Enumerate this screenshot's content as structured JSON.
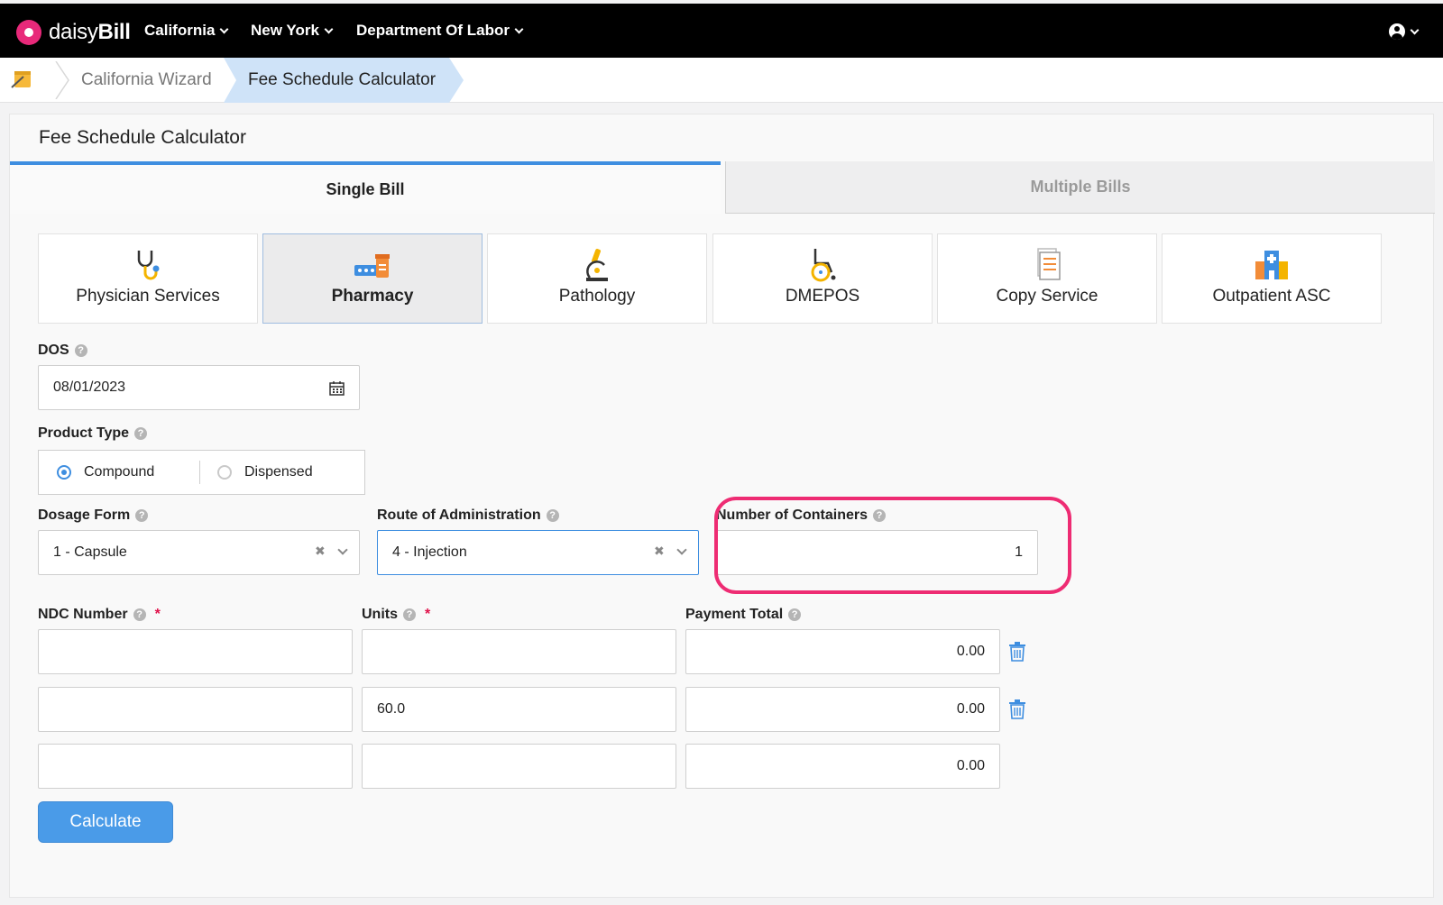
{
  "app": {
    "logo_prefix": "daisy",
    "logo_suffix": "Bill"
  },
  "nav": [
    {
      "label": "California"
    },
    {
      "label": "New York"
    },
    {
      "label": "Department Of Labor"
    }
  ],
  "breadcrumb": {
    "items": [
      "California Wizard",
      "Fee Schedule Calculator"
    ]
  },
  "panel": {
    "title": "Fee Schedule Calculator"
  },
  "tabs": [
    {
      "label": "Single Bill",
      "active": true
    },
    {
      "label": "Multiple Bills",
      "active": false
    }
  ],
  "categories": [
    {
      "label": "Physician Services",
      "icon": "stethoscope-icon"
    },
    {
      "label": "Pharmacy",
      "icon": "pharmacy-icon",
      "active": true
    },
    {
      "label": "Pathology",
      "icon": "microscope-icon"
    },
    {
      "label": "DMEPOS",
      "icon": "wheelchair-icon"
    },
    {
      "label": "Copy Service",
      "icon": "document-icon"
    },
    {
      "label": "Outpatient ASC",
      "icon": "hospital-icon"
    }
  ],
  "form": {
    "dos": {
      "label": "DOS",
      "value": "08/01/2023"
    },
    "product_type": {
      "label": "Product Type",
      "options": [
        "Compound",
        "Dispensed"
      ],
      "selected": "Compound"
    },
    "dosage_form": {
      "label": "Dosage Form",
      "value": "1 - Capsule"
    },
    "route": {
      "label": "Route of Administration",
      "value": "4 - Injection"
    },
    "containers": {
      "label": "Number of Containers",
      "value": "1"
    },
    "columns": {
      "ndc": "NDC Number",
      "units": "Units",
      "payment": "Payment Total",
      "required_mark": "*"
    },
    "rows": [
      {
        "ndc": "",
        "units": "",
        "payment": "0.00"
      },
      {
        "ndc": "",
        "units": "60.0",
        "payment": "0.00"
      },
      {
        "ndc": "",
        "units": "",
        "payment": "0.00"
      }
    ],
    "calculate_label": "Calculate"
  },
  "colors": {
    "accent": "#3e8ee0",
    "highlight": "#ee2c73",
    "brand": "#e8297a",
    "nav_bg": "#000000"
  }
}
